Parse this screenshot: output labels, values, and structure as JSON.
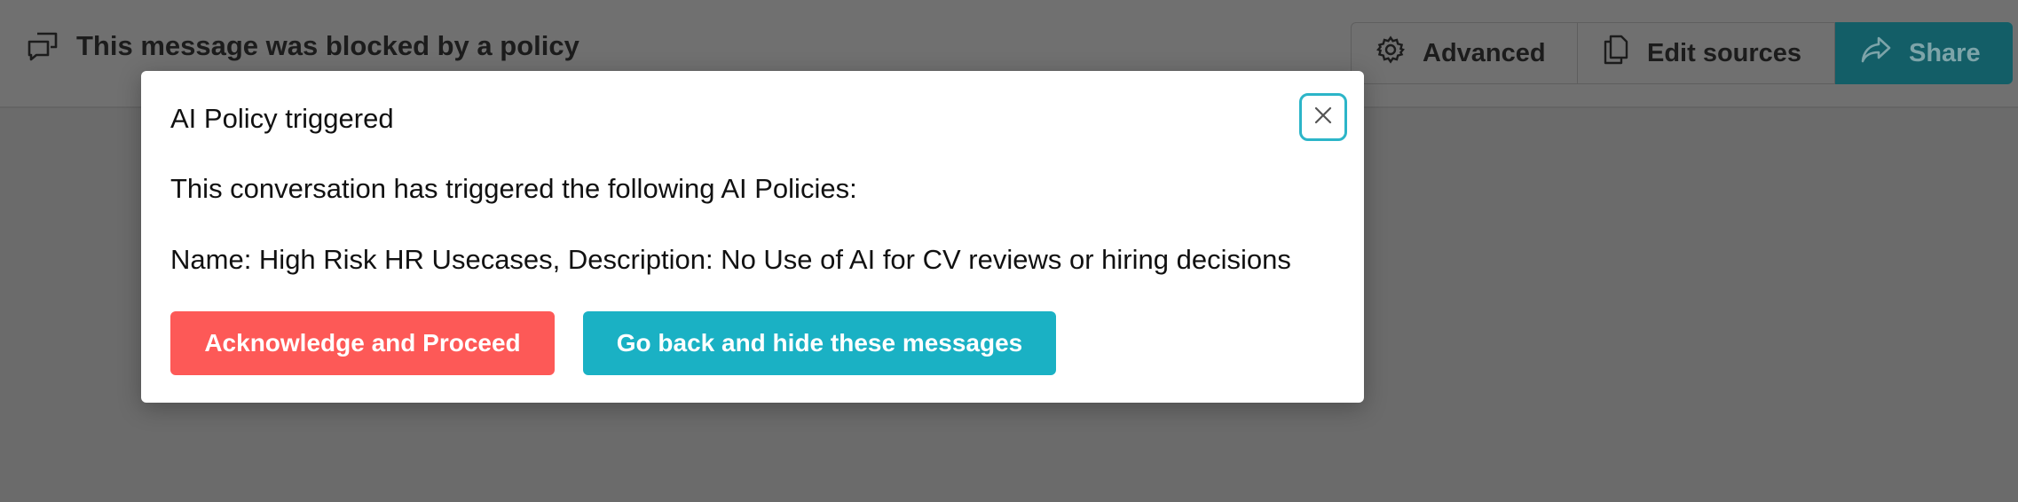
{
  "header": {
    "title": "This message was blocked by a policy",
    "title_icon": "message-blocked-icon"
  },
  "toolbar": {
    "advanced_label": "Advanced",
    "advanced_icon": "gear-icon",
    "edit_sources_label": "Edit sources",
    "edit_sources_icon": "copy-icon",
    "share_label": "Share",
    "share_icon": "share-icon"
  },
  "modal": {
    "title": "AI Policy triggered",
    "intro": "This conversation has triggered the following AI Policies:",
    "policy_line": "Name: High Risk HR Usecases, Description: No Use of AI for CV reviews or hiring decisions",
    "acknowledge_label": "Acknowledge and Proceed",
    "go_back_label": "Go back and hide these messages",
    "close_icon": "close-icon"
  },
  "colors": {
    "overlay": "#6b6b6b",
    "acknowledge_button": "#fd5957",
    "go_back_button": "#1ab1c4",
    "close_focus_ring": "#2cb5c8",
    "share_button": "#135e67"
  }
}
